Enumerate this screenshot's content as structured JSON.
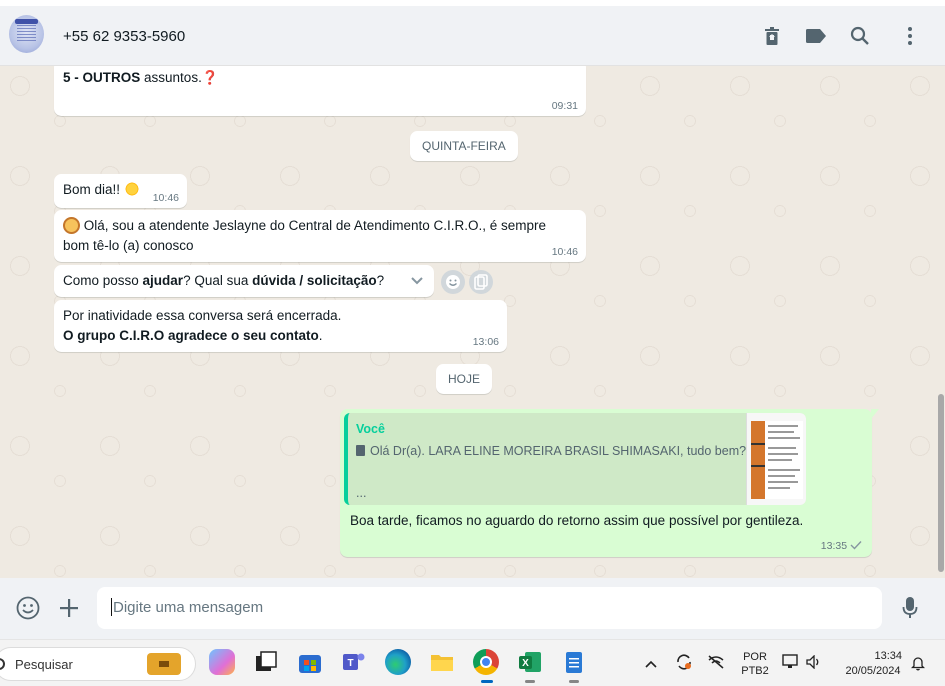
{
  "header": {
    "contact": "+55 62 9353-5960",
    "icons": [
      "trash-icon",
      "label-icon",
      "search-icon",
      "menu-dots-icon"
    ]
  },
  "messages": [
    {
      "type": "in",
      "prefix": "5 - ",
      "bold": "OUTROS",
      "text": " assuntos.",
      "emoji": "❓",
      "time": "09:31"
    },
    {
      "type": "day",
      "label": "QUINTA-FEIRA"
    },
    {
      "type": "in",
      "text": "Bom dia!! ",
      "emoji": "sun-emoji",
      "time": "10:46"
    },
    {
      "type": "in",
      "line1": " Olá, sou a atendente Jeslayne do Central de Atendimento C.I.R.O., é sempre",
      "line2": "bom tê-lo (a) conosco",
      "time": "10:46"
    },
    {
      "type": "in",
      "a": "Como posso ",
      "b": "ajudar",
      "c": "? Qual sua ",
      "d": "dúvida / solicitação",
      "e": "?"
    },
    {
      "type": "in",
      "line1": "Por inatividade essa conversa será encerrada.",
      "line2_bold": "O grupo C.I.R.O agradece o seu contato",
      "line2_end": ".",
      "time": "13:06"
    },
    {
      "type": "day",
      "label": "HOJE"
    },
    {
      "type": "out",
      "quote_author": "Você",
      "quote_text": "Olá Dr(a). LARA ELINE MOREIRA BRASIL SHIMASAKI, tudo bem?",
      "quote_more": "...",
      "text": "Boa tarde, ficamos no aguardo do retorno assim que possível por gentileza.",
      "time": "13:35"
    }
  ],
  "composer": {
    "placeholder": "Digite uma mensagem"
  },
  "taskbar": {
    "search": "Pesquisar",
    "lang1": "POR",
    "lang2": "PTB2",
    "time": "13:34",
    "date": "20/05/2024"
  },
  "colors": {
    "accent": "#06cf9c",
    "out_bubble": "#d9fdd3",
    "chat_bg": "#efeae2"
  }
}
